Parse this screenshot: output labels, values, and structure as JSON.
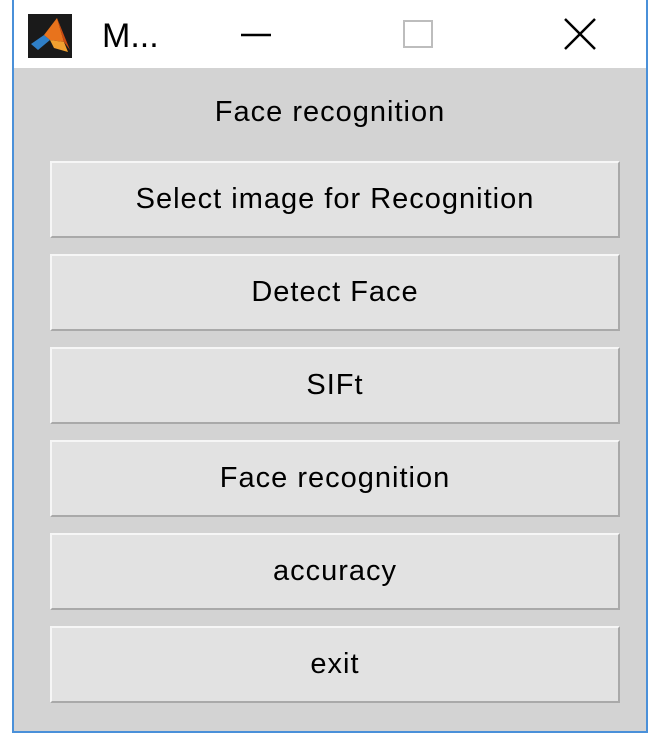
{
  "window": {
    "title": "M...",
    "icon": "matlab-icon",
    "controls": {
      "minimize_icon": "minimize-icon",
      "maximize_icon": "maximize-icon",
      "close_icon": "close-icon"
    }
  },
  "panel": {
    "heading": "Face recognition",
    "buttons": [
      {
        "label": "Select image for Recognition"
      },
      {
        "label": "Detect Face"
      },
      {
        "label": "SIFt"
      },
      {
        "label": "Face recognition"
      },
      {
        "label": "accuracy"
      },
      {
        "label": "exit"
      }
    ]
  },
  "colors": {
    "window_background": "#d3d3d3",
    "button_face": "#e2e2e2",
    "window_border": "#4a90d9"
  }
}
